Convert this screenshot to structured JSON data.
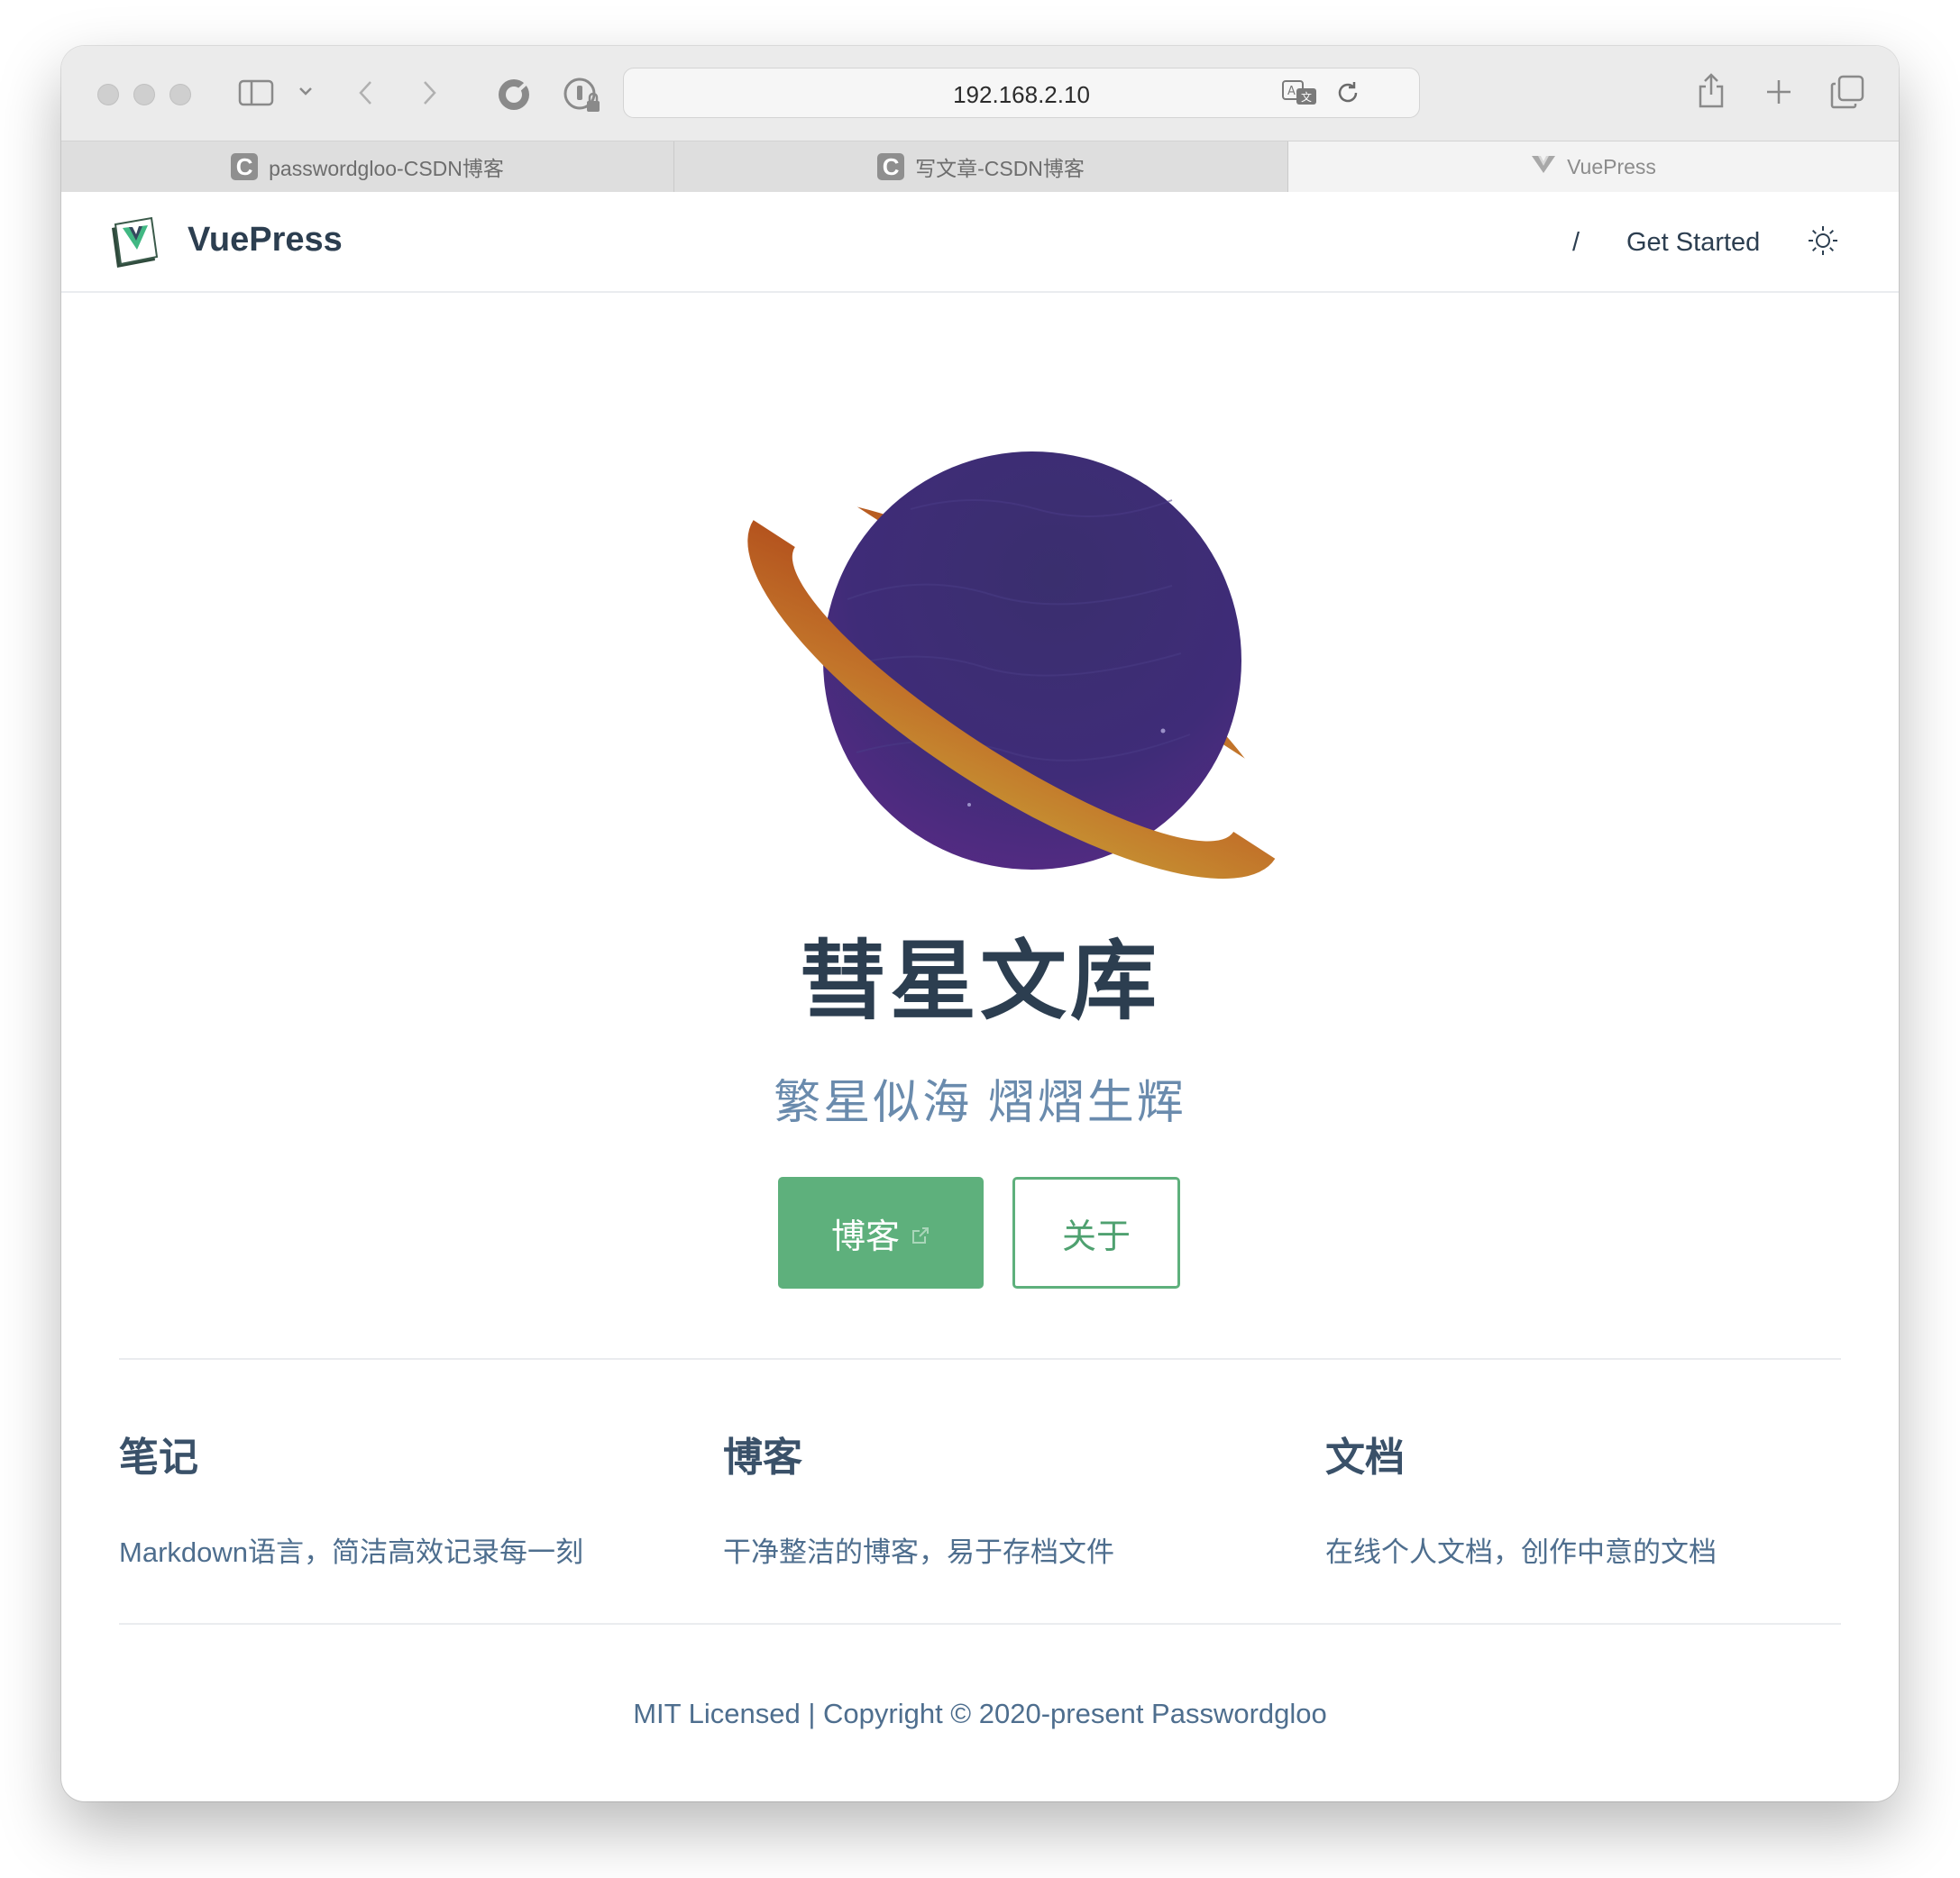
{
  "browser": {
    "url": "192.168.2.10",
    "tabs": [
      {
        "title": "passwordgloo-CSDN博客",
        "favicon": "C"
      },
      {
        "title": "写文章-CSDN博客",
        "favicon": "C"
      },
      {
        "title": "VuePress",
        "favicon": "vuepress-logo"
      }
    ]
  },
  "navbar": {
    "site_name": "VuePress",
    "links": [
      "/",
      "Get Started"
    ],
    "theme_toggle_icon": "sun-icon"
  },
  "hero": {
    "title": "彗星文库",
    "tagline": "繁星似海 熠熠生辉",
    "actions": [
      {
        "label": "博客",
        "external": true
      },
      {
        "label": "关于"
      }
    ]
  },
  "features": [
    {
      "title": "笔记",
      "details": "Markdown语言，简洁高效记录每一刻"
    },
    {
      "title": "博客",
      "details": "干净整洁的博客，易于存档文件"
    },
    {
      "title": "文档",
      "details": "在线个人文档，创作中意的文档"
    }
  ],
  "footer": {
    "text": "MIT Licensed | Copyright © 2020-present Passwordgloo"
  },
  "colors": {
    "accent": "#5eb07c",
    "text": "#2c3e50",
    "muted": "#6a8bad"
  }
}
